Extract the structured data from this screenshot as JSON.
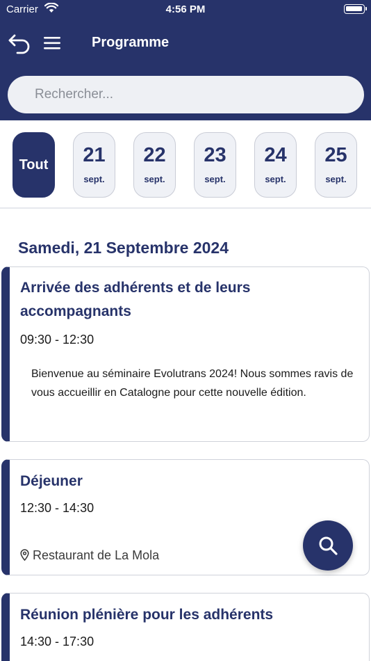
{
  "status_bar": {
    "carrier": "Carrier",
    "time": "4:56 PM"
  },
  "header": {
    "title": "Programme"
  },
  "search": {
    "placeholder": "Rechercher..."
  },
  "date_filter": {
    "all_label": "Tout",
    "days": [
      {
        "day": "21",
        "month": "sept."
      },
      {
        "day": "22",
        "month": "sept."
      },
      {
        "day": "23",
        "month": "sept."
      },
      {
        "day": "24",
        "month": "sept."
      },
      {
        "day": "25",
        "month": "sept."
      }
    ]
  },
  "sections": [
    {
      "heading": "Samedi, 21 Septembre 2024",
      "events": [
        {
          "title": "Arrivée des adhérents et de leurs accompagnants",
          "time": "09:30 - 12:30",
          "description": "Bienvenue au séminaire Evolutrans 2024! Nous sommes ravis de vous accueillir en Catalogne pour cette nouvelle édition."
        },
        {
          "title": "Déjeuner",
          "time": "12:30 - 14:30",
          "location": "Restaurant de La Mola"
        },
        {
          "title": "Réunion plénière pour les adhérents",
          "time": "14:30 - 17:30"
        }
      ]
    }
  ],
  "colors": {
    "primary": "#27336a",
    "search_bg": "#eef0f4",
    "chip_bg": "#eff1f6"
  },
  "icons": {
    "back": "back-arrow-icon",
    "menu": "hamburger-menu-icon",
    "fab": "search-icon",
    "location": "map-pin-icon"
  }
}
